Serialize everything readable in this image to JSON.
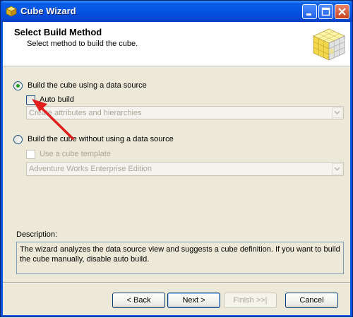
{
  "window": {
    "title": "Cube Wizard"
  },
  "header": {
    "title": "Select Build Method",
    "subtitle": "Select method to build the cube."
  },
  "options": {
    "with_source_label": "Build the cube using a data source",
    "auto_build_label": "Auto build",
    "auto_build_combo_value": "Create attributes and hierarchies",
    "without_source_label": "Build the cube without using a data source",
    "template_label": "Use a cube template",
    "template_combo_value": "Adventure Works Enterprise Edition"
  },
  "description": {
    "label": "Description:",
    "text": "The wizard analyzes the data source view and suggests a cube definition. If you want to build the cube manually, disable auto build."
  },
  "buttons": {
    "back": "< Back",
    "next": "Next >",
    "finish": "Finish >>|",
    "cancel": "Cancel"
  },
  "state": {
    "selected_option": "with_source",
    "auto_build_checked": false
  },
  "colors": {
    "annotation_arrow": "#e0201e",
    "title_bar": "#0554e3",
    "radio_dot": "#21a121"
  }
}
